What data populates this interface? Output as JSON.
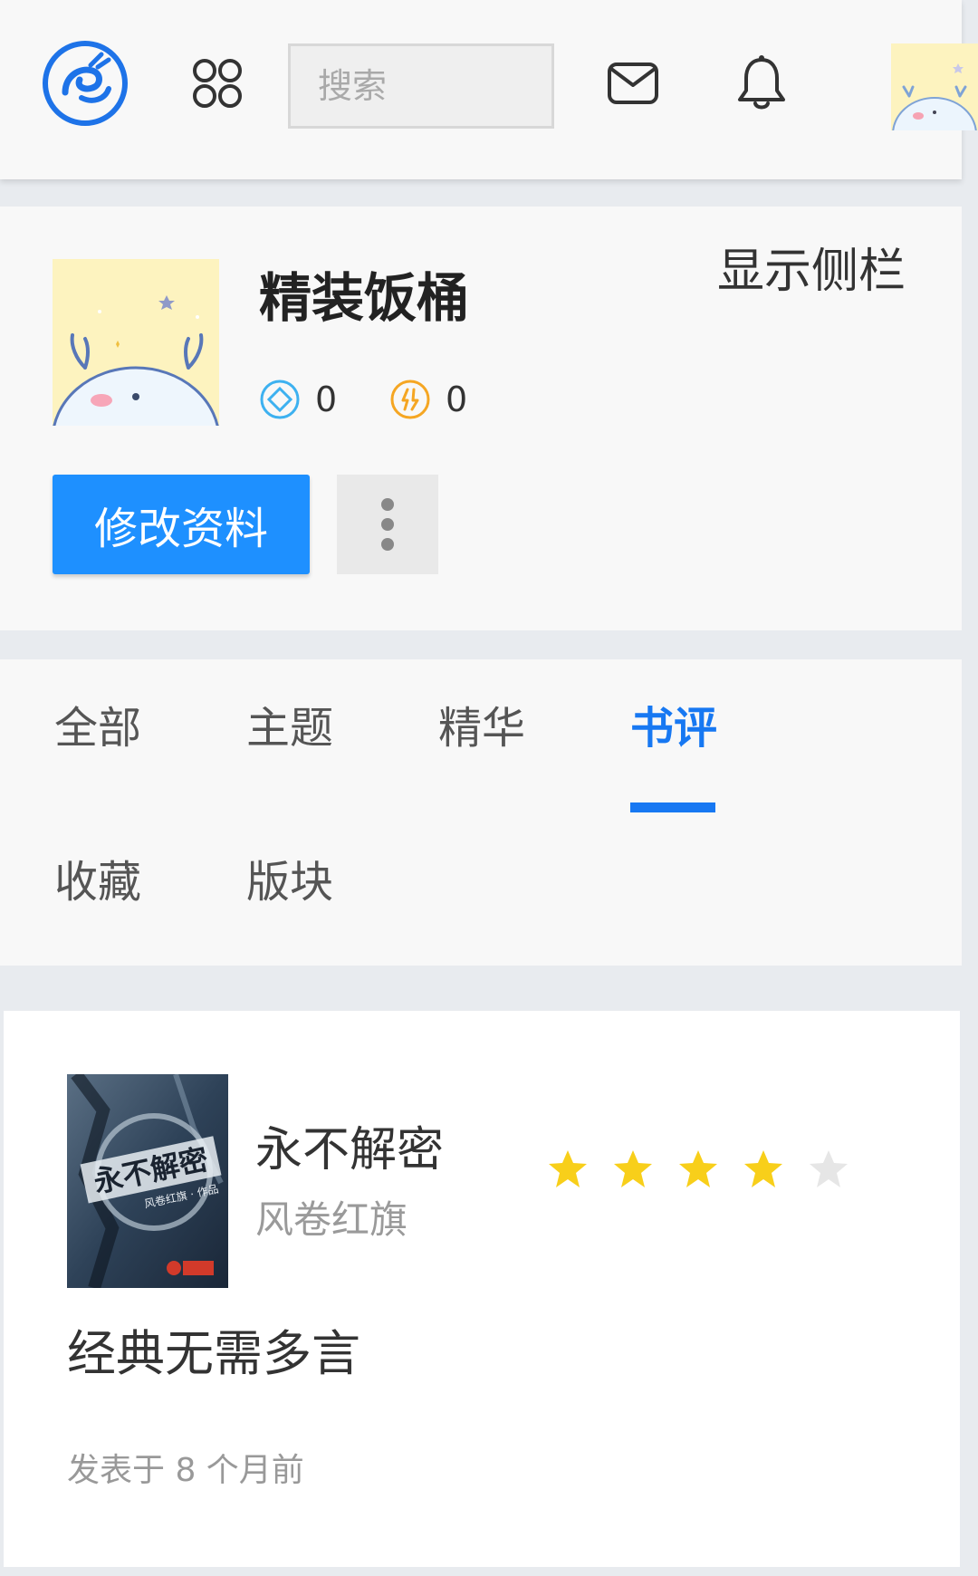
{
  "header": {
    "search_placeholder": "搜索"
  },
  "profile": {
    "username": "精装饭桶",
    "stats": [
      {
        "icon": "diamond-icon",
        "value": "0",
        "color": "#3db1f0"
      },
      {
        "icon": "gold-coin-icon",
        "value": "0",
        "color": "#f5a623"
      }
    ],
    "sidebar_toggle_label": "显示侧栏",
    "edit_button_label": "修改资料"
  },
  "tabs": {
    "items": [
      "全部",
      "主题",
      "精华",
      "书评",
      "收藏",
      "版块"
    ],
    "active_index": 3
  },
  "review": {
    "book_title": "永不解密",
    "book_author": "风卷红旗",
    "cover_title": "永不解密",
    "cover_subtitle": "风卷红旗 · 作品",
    "rating": 4,
    "rating_max": 5,
    "text": "经典无需多言",
    "time": "发表于 8 个月前"
  },
  "colors": {
    "accent": "#1778f2",
    "button": "#1e90ff",
    "star_on": "#f8cf1a",
    "star_off": "#e6e6e6"
  }
}
